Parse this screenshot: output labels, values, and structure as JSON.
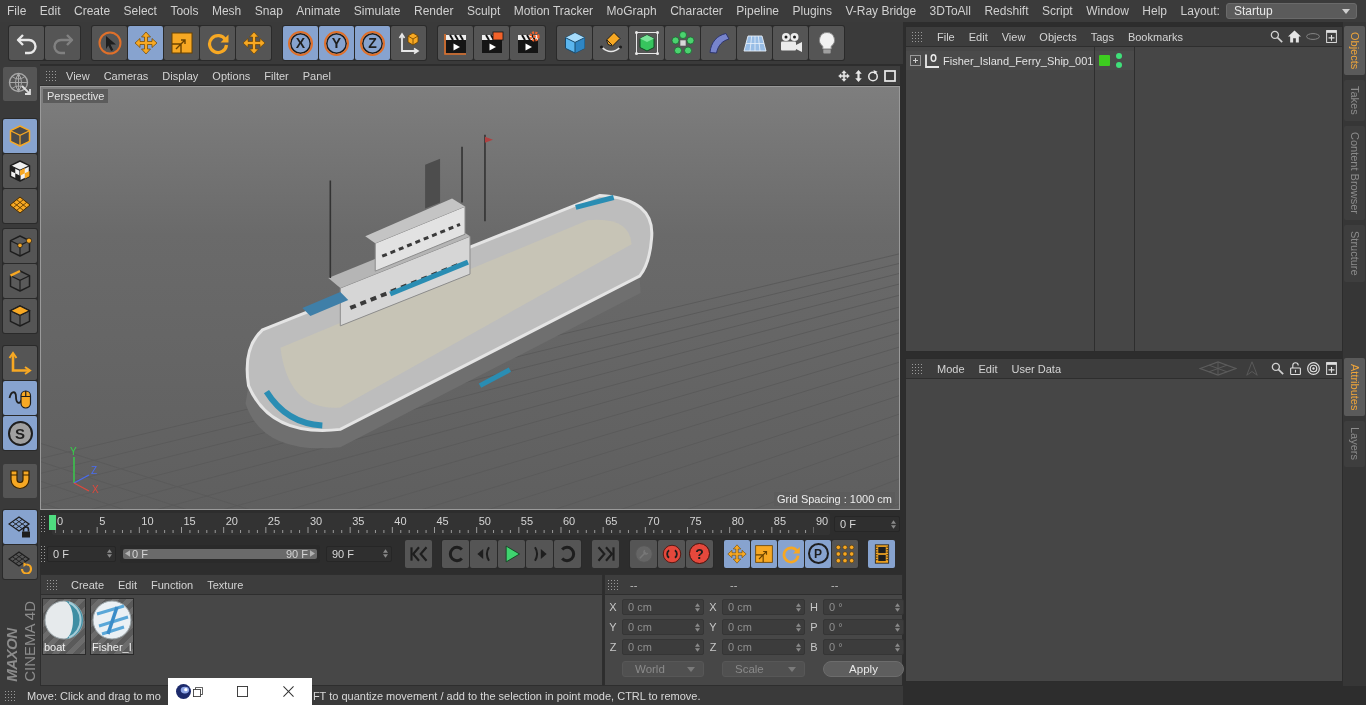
{
  "menu_bar": {
    "items": [
      "File",
      "Edit",
      "Create",
      "Select",
      "Tools",
      "Mesh",
      "Snap",
      "Animate",
      "Simulate",
      "Render",
      "Sculpt",
      "Motion Tracker",
      "MoGraph",
      "Character",
      "Pipeline",
      "Plugins",
      "V-Ray Bridge",
      "3DToAll",
      "Redshift",
      "Script",
      "Window",
      "Help"
    ],
    "layout": {
      "label": "Layout:",
      "value": "Startup"
    }
  },
  "toolbar": {
    "history": [
      {
        "kind": "undo",
        "disabled": false
      },
      {
        "kind": "redo",
        "disabled": true
      }
    ],
    "tools": [
      {
        "kind": "select",
        "selected": false
      },
      {
        "kind": "move",
        "selected": true
      },
      {
        "kind": "scale",
        "selected": false
      },
      {
        "kind": "rotate",
        "selected": false
      },
      {
        "kind": "transform",
        "selected": false
      }
    ],
    "axes": [
      {
        "kind": "axis",
        "label": "X",
        "selected": true
      },
      {
        "kind": "axis",
        "label": "Y",
        "selected": true
      },
      {
        "kind": "axis",
        "label": "Z",
        "selected": true
      },
      {
        "kind": "coords",
        "selected": false
      }
    ],
    "render": [
      {
        "kind": "renderview"
      },
      {
        "kind": "renderpv"
      },
      {
        "kind": "rendersettings"
      }
    ],
    "create": [
      {
        "kind": "cube"
      },
      {
        "kind": "pen"
      },
      {
        "kind": "subdivision"
      },
      {
        "kind": "cloner"
      },
      {
        "kind": "bend"
      },
      {
        "kind": "floor"
      },
      {
        "kind": "camera"
      },
      {
        "kind": "light"
      }
    ]
  },
  "left_toolbar": {
    "groups": [
      [
        {
          "kind": "editable",
          "selected": false
        }
      ],
      [
        {
          "kind": "model",
          "selected": true
        },
        {
          "kind": "texture",
          "selected": false
        },
        {
          "kind": "workplane",
          "selected": false
        }
      ],
      [
        {
          "kind": "points",
          "selected": false
        },
        {
          "kind": "edges",
          "selected": false
        },
        {
          "kind": "polygons",
          "selected": false
        }
      ],
      [
        {
          "kind": "axismode",
          "selected": false
        },
        {
          "kind": "tweak",
          "selected": true
        },
        {
          "kind": "snap",
          "label": "S",
          "selected": true
        }
      ],
      [
        {
          "kind": "magnet",
          "selected": false
        }
      ],
      [
        {
          "kind": "lock",
          "selected": true
        },
        {
          "kind": "gridsnap",
          "selected": false
        }
      ]
    ],
    "logo": {
      "brand": "MAXON",
      "product": "CINEMA 4D"
    }
  },
  "viewport": {
    "menu": [
      "View",
      "Cameras",
      "Display",
      "Options",
      "Filter",
      "Panel"
    ],
    "camera": "Perspective",
    "grid_spacing": "Grid Spacing : 1000 cm",
    "axis_labels": [
      "Y",
      "Z",
      "X"
    ]
  },
  "timeline": {
    "ticks": [
      "0",
      "5",
      "10",
      "15",
      "20",
      "25",
      "30",
      "35",
      "40",
      "45",
      "50",
      "55",
      "60",
      "65",
      "70",
      "75",
      "80",
      "85",
      "90"
    ],
    "playhead": {
      "level": 0
    },
    "current_frame": "0 F"
  },
  "playback": {
    "start": "0 F",
    "range": {
      "start": "0 F",
      "end": "90 F",
      "level": 1
    },
    "end": "90 F",
    "transport": [
      [
        {
          "kind": "first"
        }
      ],
      [
        {
          "kind": "prevkey"
        },
        {
          "kind": "prevframe"
        },
        {
          "kind": "play"
        },
        {
          "kind": "nextframe"
        },
        {
          "kind": "nextkey"
        }
      ],
      [
        {
          "kind": "last"
        }
      ]
    ],
    "record": [
      {
        "kind": "record",
        "disabled": true
      },
      {
        "kind": "autokey",
        "disabled": false
      },
      {
        "kind": "keyselect",
        "label": "?",
        "disabled": false
      }
    ],
    "keys": [
      {
        "kind": "movekey",
        "selected": true
      },
      {
        "kind": "scalekey",
        "selected": true
      },
      {
        "kind": "rotatekey",
        "selected": true
      },
      {
        "kind": "paramkey",
        "label": "P",
        "selected": true
      },
      {
        "kind": "pointkey",
        "selected": false
      }
    ],
    "timeline_button": {
      "kind": "film",
      "selected": true
    }
  },
  "materials": {
    "menu": [
      "Create",
      "Edit",
      "Function",
      "Texture"
    ],
    "items": [
      {
        "kind": "boat",
        "name": "boat"
      },
      {
        "kind": "logo",
        "name": "Fisher_I"
      }
    ]
  },
  "coordinates": {
    "headers": [
      "--",
      "--",
      "--"
    ],
    "columns": [
      [
        {
          "label": "X",
          "value": "0 cm"
        },
        {
          "label": "Y",
          "value": "0 cm"
        },
        {
          "label": "Z",
          "value": "0 cm"
        }
      ],
      [
        {
          "label": "X",
          "value": "0 cm"
        },
        {
          "label": "Y",
          "value": "0 cm"
        },
        {
          "label": "Z",
          "value": "0 cm"
        }
      ],
      [
        {
          "label": "H",
          "value": "0 °"
        },
        {
          "label": "P",
          "value": "0 °"
        },
        {
          "label": "B",
          "value": "0 °"
        }
      ]
    ],
    "dropdowns": [
      "World",
      "Scale"
    ],
    "apply": "Apply"
  },
  "status_bar": {
    "texts": [
      "Move: Click and drag to mo",
      "FT to quantize movement / add to the selection in point mode, CTRL to remove."
    ]
  },
  "popup": {
    "controls": [
      {
        "kind": "app"
      },
      {
        "kind": "restore"
      },
      {
        "kind": "maximize"
      },
      {
        "kind": "close"
      }
    ]
  },
  "object_manager": {
    "menu": [
      "File",
      "Edit",
      "View",
      "Objects",
      "Tags",
      "Bookmarks"
    ],
    "objects": [
      {
        "name": "Fisher_Island_Ferry_Ship_001",
        "expanded": false,
        "editor_visible": true,
        "render_visible": true
      }
    ]
  },
  "side_tabs": {
    "top": [
      {
        "label": "Objects",
        "selected": true
      },
      {
        "label": "Takes",
        "selected": false
      },
      {
        "label": "Content Browser",
        "selected": false
      },
      {
        "label": "Structure",
        "selected": false
      }
    ],
    "bottom": [
      {
        "label": "Attributes",
        "selected": true
      },
      {
        "label": "Layers",
        "selected": false
      }
    ]
  },
  "attribute_manager": {
    "menu": [
      "Mode",
      "Edit",
      "User Data"
    ]
  }
}
